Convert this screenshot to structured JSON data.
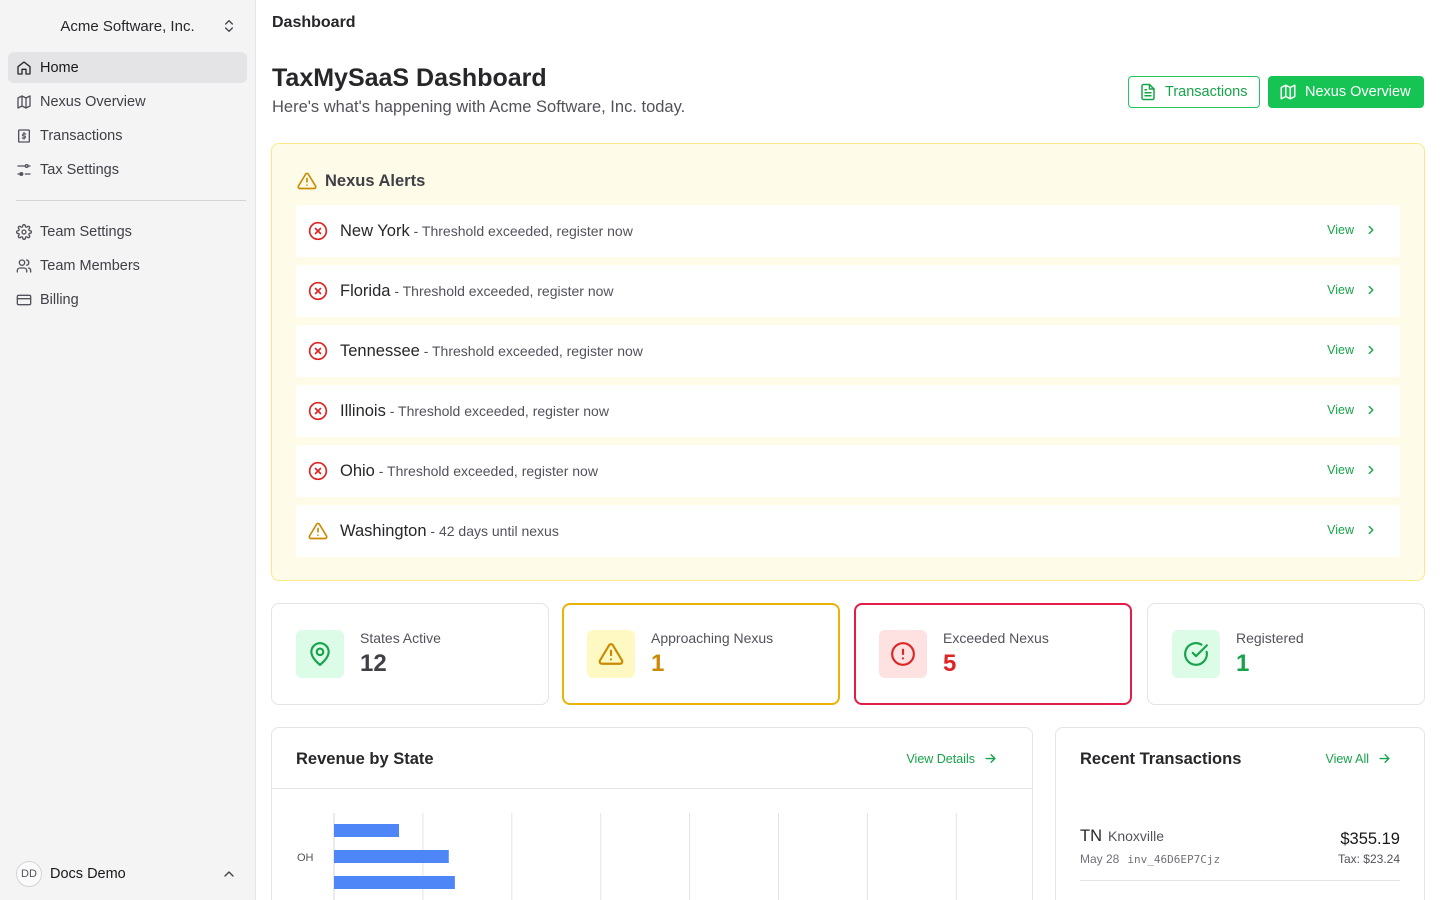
{
  "sidebar": {
    "org_name": "Acme Software, Inc.",
    "nav_main": [
      {
        "label": "Home",
        "icon": "home-icon",
        "active": true
      },
      {
        "label": "Nexus Overview",
        "icon": "map-icon"
      },
      {
        "label": "Transactions",
        "icon": "receipt-dollar-icon"
      },
      {
        "label": "Tax Settings",
        "icon": "sliders-icon"
      }
    ],
    "nav_secondary": [
      {
        "label": "Team Settings",
        "icon": "gear-icon"
      },
      {
        "label": "Team Members",
        "icon": "users-icon"
      },
      {
        "label": "Billing",
        "icon": "credit-card-icon"
      }
    ],
    "user": {
      "initials": "DD",
      "name": "Docs Demo"
    }
  },
  "header": {
    "breadcrumb": "Dashboard",
    "title": "TaxMySaaS Dashboard",
    "subtitle": "Here's what's happening with Acme Software, Inc. today.",
    "transactions_button": "Transactions",
    "nexus_button": "Nexus Overview"
  },
  "alerts": {
    "title": "Nexus Alerts",
    "items": [
      {
        "state": "New York",
        "message": " - Threshold exceeded, register now",
        "severity": "exceeded",
        "action": "View"
      },
      {
        "state": "Florida",
        "message": " - Threshold exceeded, register now",
        "severity": "exceeded",
        "action": "View"
      },
      {
        "state": "Tennessee",
        "message": " - Threshold exceeded, register now",
        "severity": "exceeded",
        "action": "View"
      },
      {
        "state": "Illinois",
        "message": " - Threshold exceeded, register now",
        "severity": "exceeded",
        "action": "View"
      },
      {
        "state": "Ohio",
        "message": " - Threshold exceeded, register now",
        "severity": "exceeded",
        "action": "View"
      },
      {
        "state": "Washington",
        "message": " - 42 days until nexus",
        "severity": "approaching",
        "action": "View"
      }
    ]
  },
  "stats": [
    {
      "label": "States Active",
      "value": "12",
      "icon": "map-pin-icon",
      "tone": "neutral"
    },
    {
      "label": "Approaching Nexus",
      "value": "1",
      "icon": "warning-icon",
      "tone": "warn"
    },
    {
      "label": "Exceeded Nexus",
      "value": "5",
      "icon": "alert-circle-icon",
      "tone": "err"
    },
    {
      "label": "Registered",
      "value": "1",
      "icon": "check-circle-icon",
      "tone": "ok"
    }
  ],
  "revenue": {
    "title": "Revenue by State",
    "link": "View Details"
  },
  "chart_data": {
    "type": "bar",
    "orientation": "horizontal",
    "categories": [
      "OH"
    ],
    "series": [
      {
        "values": [
          64
        ]
      },
      {
        "values": [
          113
        ]
      },
      {
        "values": [
          119
        ]
      }
    ],
    "gridlines": true,
    "xlim": [
      0,
      700
    ]
  },
  "recent": {
    "title": "Recent Transactions",
    "link": "View All",
    "items": [
      {
        "state": "TN",
        "city": "Knoxville",
        "date": "May 28",
        "id": "inv_46D6EP7Cjz",
        "amount": "$355.19",
        "tax": "Tax: $23.24"
      }
    ]
  },
  "colors": {
    "accent": "#16c454",
    "accent_text": "#16a34a",
    "alert_bg": "#fefce8",
    "error": "#dc2626",
    "warning": "#ca8a04",
    "bar": "#4f86f7"
  }
}
